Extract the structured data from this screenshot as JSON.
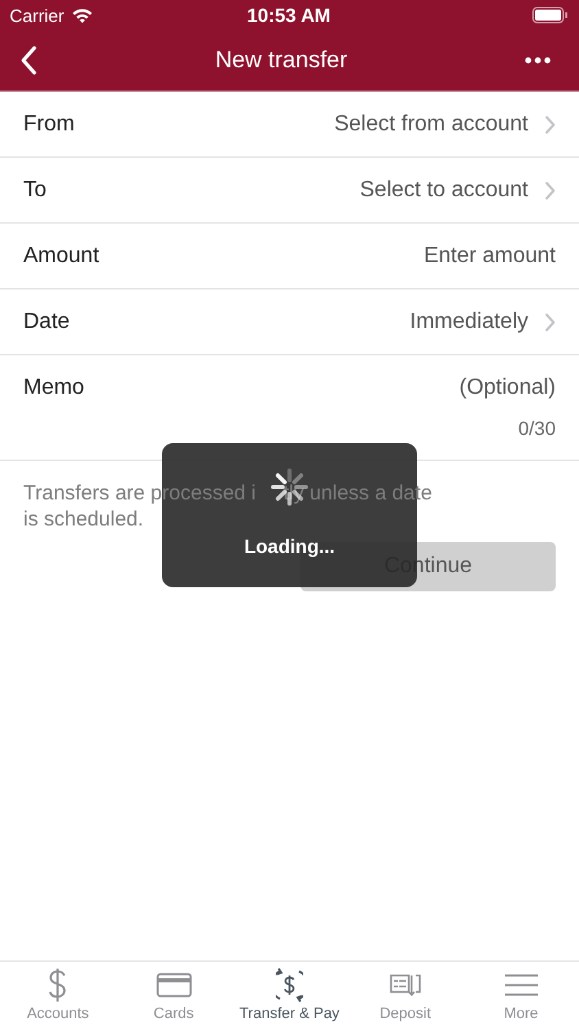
{
  "status_bar": {
    "carrier": "Carrier",
    "time": "10:53 AM"
  },
  "nav_bar": {
    "title": "New transfer"
  },
  "form": {
    "rows": [
      {
        "kind": "select",
        "label": "From",
        "value": "Select from account"
      },
      {
        "kind": "select",
        "label": "To",
        "value": "Select to account"
      },
      {
        "kind": "input",
        "label": "Amount",
        "placeholder": "Enter amount"
      },
      {
        "kind": "select",
        "label": "Date",
        "value": "Immediately"
      },
      {
        "kind": "memo",
        "label": "Memo",
        "placeholder": "(Optional)",
        "counter": "0/30"
      }
    ]
  },
  "note": [
    "Transfers are processed i",
    "tly unless a date",
    "is scheduled."
  ],
  "continue_button": {
    "label": "Continue",
    "disabled": true
  },
  "loading_overlay": {
    "label": "Loading..."
  },
  "tab_bar": [
    {
      "kind": "dollar",
      "label": "Accounts",
      "selected": false
    },
    {
      "kind": "card",
      "label": "Cards",
      "selected": false
    },
    {
      "kind": "transfer",
      "label": "Transfer & Pay",
      "selected": true
    },
    {
      "kind": "deposit",
      "label": "Deposit",
      "selected": false
    },
    {
      "kind": "menu",
      "label": "More",
      "selected": false
    }
  ]
}
